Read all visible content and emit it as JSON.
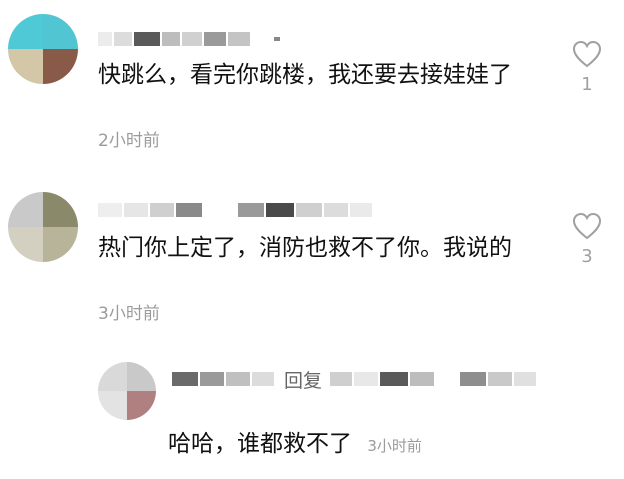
{
  "comments": [
    {
      "text": "快跳么，看完你跳楼，我还要去接娃娃了",
      "time": "2小时前",
      "likes": "1",
      "avatar_colors": [
        "#4fc9d6",
        "#52c5d3",
        "#d4c7a8",
        "#8a5a48"
      ]
    },
    {
      "text": "热门你上定了，消防也救不了你。我说的",
      "time": "3小时前",
      "likes": "3",
      "avatar_colors": [
        "#c9c9c9",
        "#8a8a6a",
        "#d3d0c2",
        "#b7b49a"
      ]
    }
  ],
  "reply": {
    "label": "回复",
    "text": "哈哈，谁都救不了",
    "time": "3小时前",
    "avatar_colors": [
      "#d9d9d9",
      "#c9c9c9",
      "#e3e3e3",
      "#b08080"
    ]
  },
  "colors": {
    "text": "#111111",
    "muted": "#9b9b9b",
    "like_icon": "#a0a0a0"
  },
  "icons": {
    "like": "heart-outline-icon"
  }
}
